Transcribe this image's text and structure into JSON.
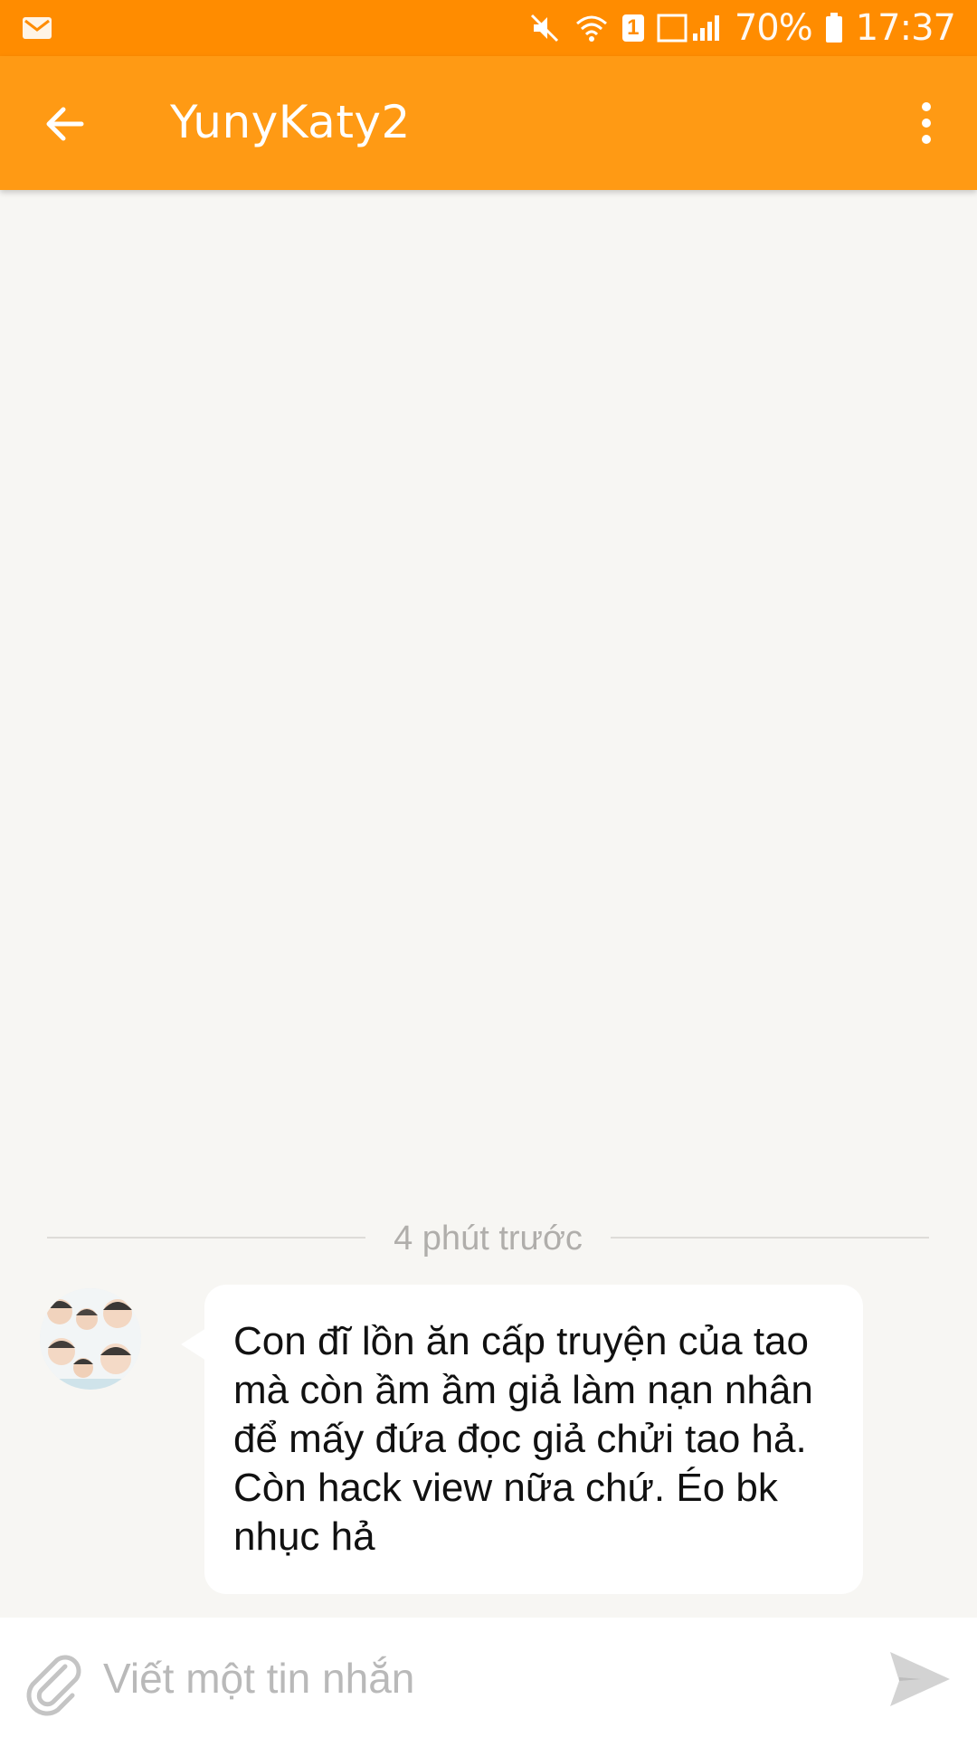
{
  "status_bar": {
    "battery_percent": "70%",
    "time": "17:37",
    "sim_badge": "1",
    "icons": [
      "mail-icon",
      "mute-icon",
      "wifi-icon",
      "signal-icon",
      "battery-icon"
    ]
  },
  "app_bar": {
    "title": "YunyKaty2",
    "back_icon": "arrow-left-icon",
    "menu_icon": "more-vertical-icon"
  },
  "conversation": {
    "timestamp": "4 phút trước",
    "messages": [
      {
        "avatar_icon": "user-avatar",
        "text": "Con đĩ lồn ăn cấp truyện của tao mà còn ầm ầm giả làm nạn nhân để mấy đứa đọc giả chửi tao hả. Còn hack view nữa chứ. Éo bk nhục hả"
      }
    ]
  },
  "composer": {
    "placeholder": "Viết một tin nhắn",
    "value": "",
    "attach_icon": "paperclip-icon",
    "send_icon": "send-icon"
  },
  "colors": {
    "status_bar": "#ff8c00",
    "app_bar": "#ff9a14",
    "background": "#f7f6f3",
    "bubble": "#ffffff"
  }
}
